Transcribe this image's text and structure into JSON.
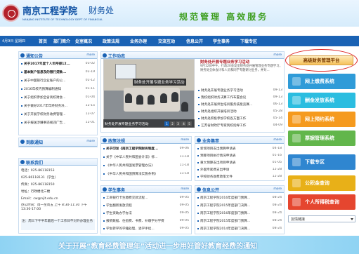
{
  "header": {
    "school_name": "南京工程学院",
    "department": "财务处",
    "english_name": "NANJING INSTITUTE OF TECHNOLOGY DEPT OF FINANCIAL",
    "slogan": "规范管理  高效服务"
  },
  "nav": {
    "date": "4月9日 星期四",
    "items": [
      "首页",
      "部门简介",
      "处室概况",
      "政策法规",
      "业务办理",
      "交流互动",
      "信息公开",
      "学生事务",
      "下载专区"
    ]
  },
  "notice": {
    "title": "通知公告",
    "more": "more",
    "items": [
      {
        "title": "关于2017年度个人年所得12...",
        "date": "03-02",
        "bold": true
      },
      {
        "title": "基本账户信息及的银行贷款...",
        "date": "02-19",
        "bold": true
      },
      {
        "title": "关于中国银行企业账户的公...",
        "date": "02-12",
        "bold": false
      },
      {
        "title": "2016年校内预算编制通知",
        "date": "01-11",
        "bold": false
      },
      {
        "title": "关于组织参加全省高校财会...",
        "date": "01-04",
        "bold": false
      },
      {
        "title": "关于做好2017年年终财务决...",
        "date": "12-15",
        "bold": false
      },
      {
        "title": "关于开展学校财务收费管理...",
        "date": "12-07",
        "bold": false
      },
      {
        "title": "关于报送涉嫌事违规违广告...",
        "date": "12-01",
        "bold": false
      }
    ]
  },
  "tsnotice": {
    "title": "到款通知",
    "more": "more"
  },
  "contact": {
    "title": "联系我们",
    "lines": [
      "电话：025-86118153",
      "025-86118131（学生）",
      "传真：025-86118150",
      "地址：行政楼北三楼",
      "Email：cw@njit.edu.cn",
      "办公时间：周一至周五 上午 8:30-11:30 下午 13:30-17:00"
    ],
    "footnote": "注：周三下午半年最后一个工作日不对外办理业务"
  },
  "work": {
    "title": "工作动态",
    "more": "more",
    "caption": "财务处开展专题业务学习活动",
    "caption2": "财务处开展专题业务学习活动",
    "pages": [
      "1",
      "2",
      "3",
      "4",
      "5"
    ]
  },
  "hot": {
    "headline": "财务处开展专题业务学习活动",
    "summary": "9月12日中午，行政20会议室财务处开展管理业务专题学习，财务处全体会计科人员和同学专题研讨业务，并对...",
    "items": [
      {
        "title": "财务处开展专题业务学习活动",
        "date": "09-13"
      },
      {
        "title": "我校组织财务决算工作布置会议",
        "date": "09-13"
      },
      {
        "title": "财务处开展师生培训服务技能竞赛...",
        "date": "06-13"
      },
      {
        "title": "财务处组织开展培训活动",
        "date": "05-28"
      },
      {
        "title": "财务处积极参加学校各方面工作",
        "date": "05-14"
      },
      {
        "title": "江苏省财政厅专家到校指导工作",
        "date": "04-09"
      }
    ]
  },
  "policy": {
    "title": "政策法规",
    "more": "more",
    "items": [
      {
        "title": "关于印发《南京工程学院财务制度...",
        "date": "09-06",
        "bold": true
      },
      {
        "title": "关于《中华人民共和国会计法》修...",
        "date": "11-18",
        "bold": false
      },
      {
        "title": "《中华人民共和国发票管理办法》",
        "date": "11-18",
        "bold": false
      },
      {
        "title": "《中华人民共和国预算法实施条例》",
        "date": "11-18",
        "bold": false
      }
    ]
  },
  "business": {
    "title": "业务集萃",
    "more": "more",
    "items": [
      {
        "title": "新增项目支出预算申请表",
        "date": "04-18"
      },
      {
        "title": "预算项目执行情况申请表",
        "date": "01-16"
      },
      {
        "title": "重大预算支出项目申请表",
        "date": "01-05"
      },
      {
        "title": "外国专家费支出申请",
        "date": "12-28"
      },
      {
        "title": "学校财务收费政策文件",
        "date": "12-28"
      }
    ]
  },
  "student": {
    "title": "学生事务",
    "more": "more",
    "items": [
      {
        "title": "工商银行卡生缴费交款流程...",
        "date": "09-05"
      },
      {
        "title": "学生翻新发放流程",
        "date": "09-05"
      },
      {
        "title": "学生资助办学办法",
        "date": "09-05"
      },
      {
        "title": "报销数据、住宿费、书费、补缴学分学费",
        "date": "09-05"
      },
      {
        "title": "学生转学的学籍处理、退学手续...",
        "date": "09-05"
      }
    ]
  },
  "info": {
    "title": "信息公开",
    "more": "more",
    "items": [
      {
        "title": "南京工程学院2016年度部门预算...",
        "date": "08-24"
      },
      {
        "title": "南京工程学院2015年度部门决算...",
        "date": "08-24"
      },
      {
        "title": "南京工程学院2016年度部门预算...",
        "date": "08-24"
      },
      {
        "title": "南京工程学院2015年度部门预算...",
        "date": "08-24"
      },
      {
        "title": "南京工程学院2014年度部门决算...",
        "date": "08-24"
      }
    ]
  },
  "right": {
    "top_button": "高级财务管理平台",
    "buttons": [
      {
        "label": "网上缴费系统",
        "color": "#2f9bd8"
      },
      {
        "label": "酬金发放系统",
        "color": "#2bbde0"
      },
      {
        "label": "网上预约系统",
        "color": "#f59a1e"
      },
      {
        "label": "票据管理系统",
        "color": "#62b64b"
      },
      {
        "label": "下载专区",
        "color": "#2f86d0"
      },
      {
        "label": "公积金查询",
        "color": "#e8b018"
      },
      {
        "label": "个人所得税查询",
        "color": "#e5462f"
      }
    ],
    "dropdown": "友情链接"
  },
  "banner": {
    "text": "关于开展“教育经费管理年”活动进一步用好管好教育经费的通知"
  }
}
